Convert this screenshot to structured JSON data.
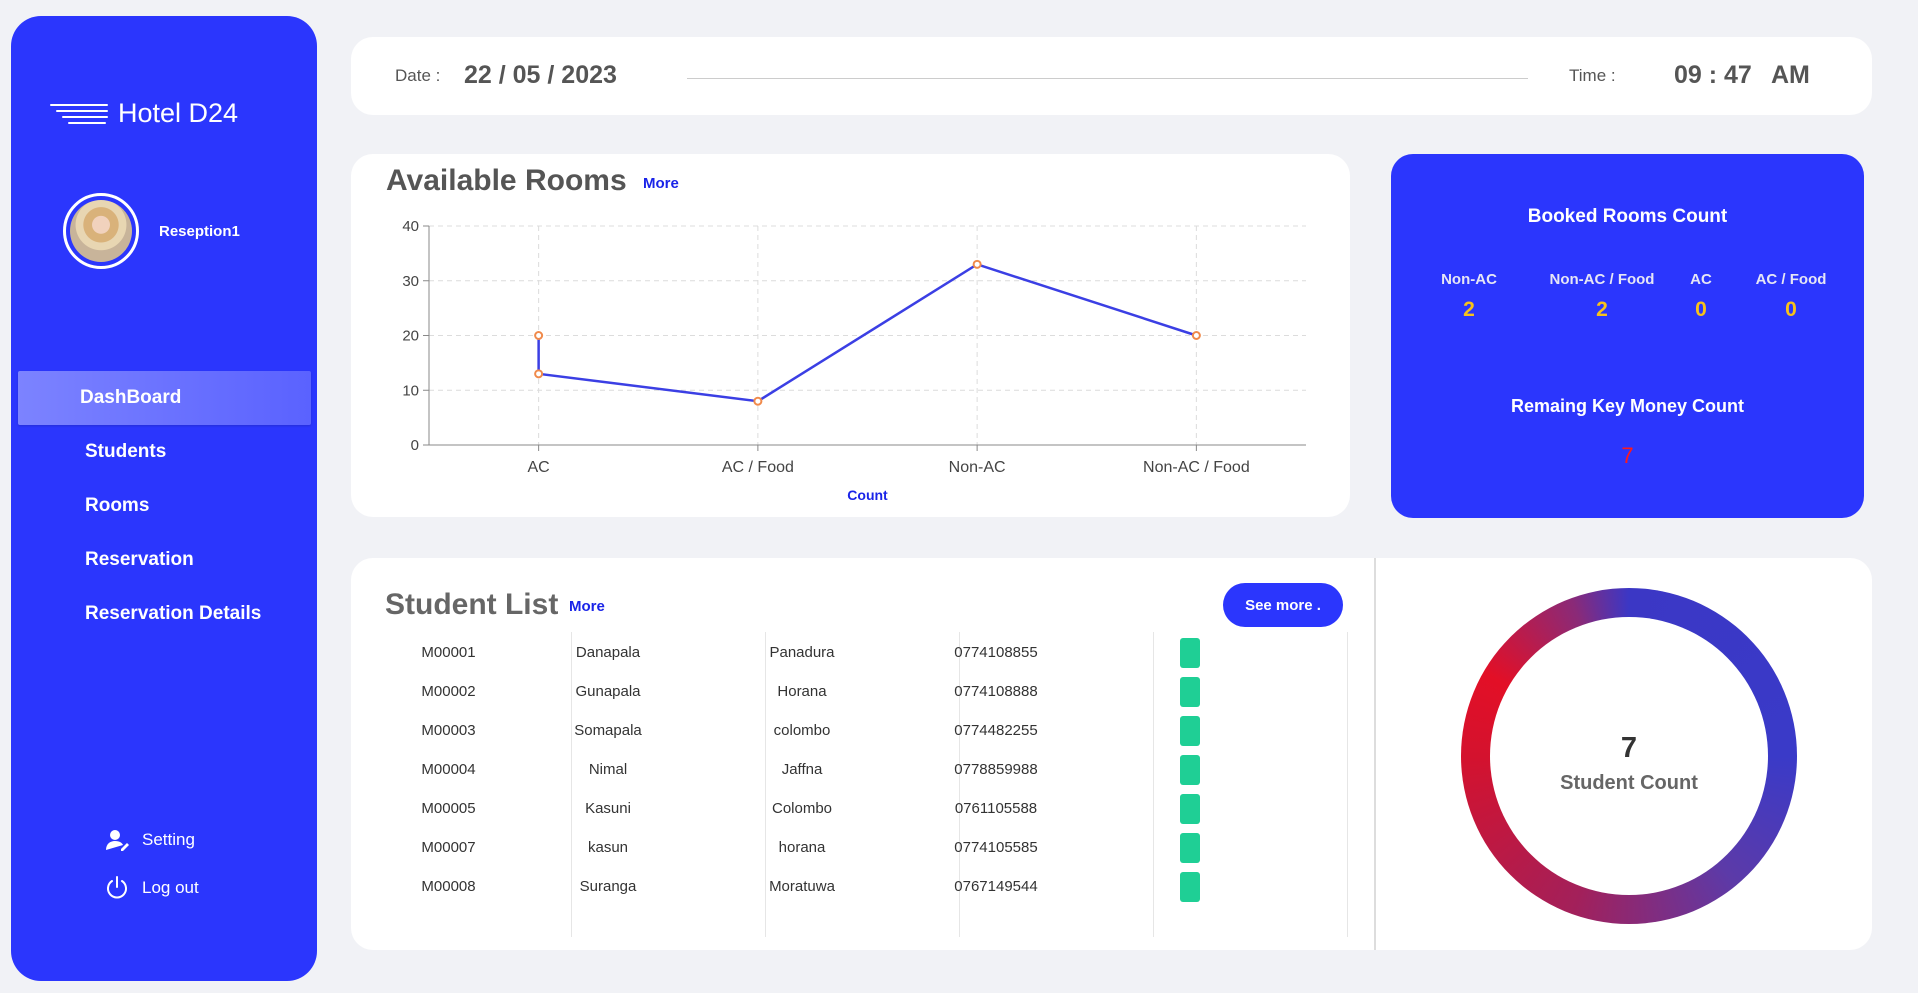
{
  "sidebar": {
    "brand": "Hotel D24",
    "user": "Reseption1",
    "nav": [
      {
        "label": "DashBoard",
        "active": true
      },
      {
        "label": "Students",
        "active": false
      },
      {
        "label": "Rooms",
        "active": false
      },
      {
        "label": "Reservation",
        "active": false
      },
      {
        "label": "Reservation Details",
        "active": false
      }
    ],
    "setting_label": "Setting",
    "logout_label": "Log out"
  },
  "topbar": {
    "date_label": "Date :",
    "date_value": "22 / 05 / 2023",
    "time_label": "Time :",
    "time_value": "09 : 47",
    "ampm": "AM"
  },
  "rooms": {
    "title": "Available Rooms",
    "more_label": "More"
  },
  "chart_data": {
    "type": "line",
    "categories": [
      "AC",
      "AC / Food",
      "Non-AC",
      "Non-AC / Food"
    ],
    "points": [
      {
        "x": "AC",
        "y": 20
      },
      {
        "x": "AC",
        "y": 13
      },
      {
        "x": "AC / Food",
        "y": 8
      },
      {
        "x": "Non-AC",
        "y": 33
      },
      {
        "x": "Non-AC / Food",
        "y": 20
      }
    ],
    "xlabel": "Count",
    "ylabel": "",
    "ylim": [
      0,
      40
    ],
    "yticks": [
      0,
      10,
      20,
      30,
      40
    ],
    "grid": true,
    "colors": {
      "line": "#3b3fe4",
      "marker": "#f08a4b"
    }
  },
  "booked": {
    "title": "Booked Rooms Count",
    "columns": [
      {
        "label": "Non-AC",
        "value": "2"
      },
      {
        "label": "Non-AC / Food",
        "value": "2"
      },
      {
        "label": "AC",
        "value": "0"
      },
      {
        "label": "AC / Food",
        "value": "0"
      }
    ],
    "key_title": "Remaing Key Money Count",
    "key_value": "7"
  },
  "students": {
    "title": "Student List",
    "more_label": "More",
    "see_more_label": "See more .",
    "rows": [
      [
        "M00001",
        "Danapala",
        "Panadura",
        "0774108855"
      ],
      [
        "M00002",
        "Gunapala",
        "Horana",
        "0774108888"
      ],
      [
        "M00003",
        "Somapala",
        "colombo",
        "0774482255"
      ],
      [
        "M00004",
        "Nimal",
        "Jaffna",
        "0778859988"
      ],
      [
        "M00005",
        "Kasuni",
        "Colombo",
        "0761105588"
      ],
      [
        "M00007",
        "kasun",
        "horana",
        "0774105585"
      ],
      [
        "M00008",
        "Suranga",
        "Moratuwa",
        "0767149544"
      ]
    ],
    "count_value": "7",
    "count_label": "Student Count"
  },
  "colors": {
    "accent": "#2b36fd",
    "status": "#1fcf95",
    "key_money": "#ff1a1a",
    "booked_value": "#f7c21b"
  }
}
